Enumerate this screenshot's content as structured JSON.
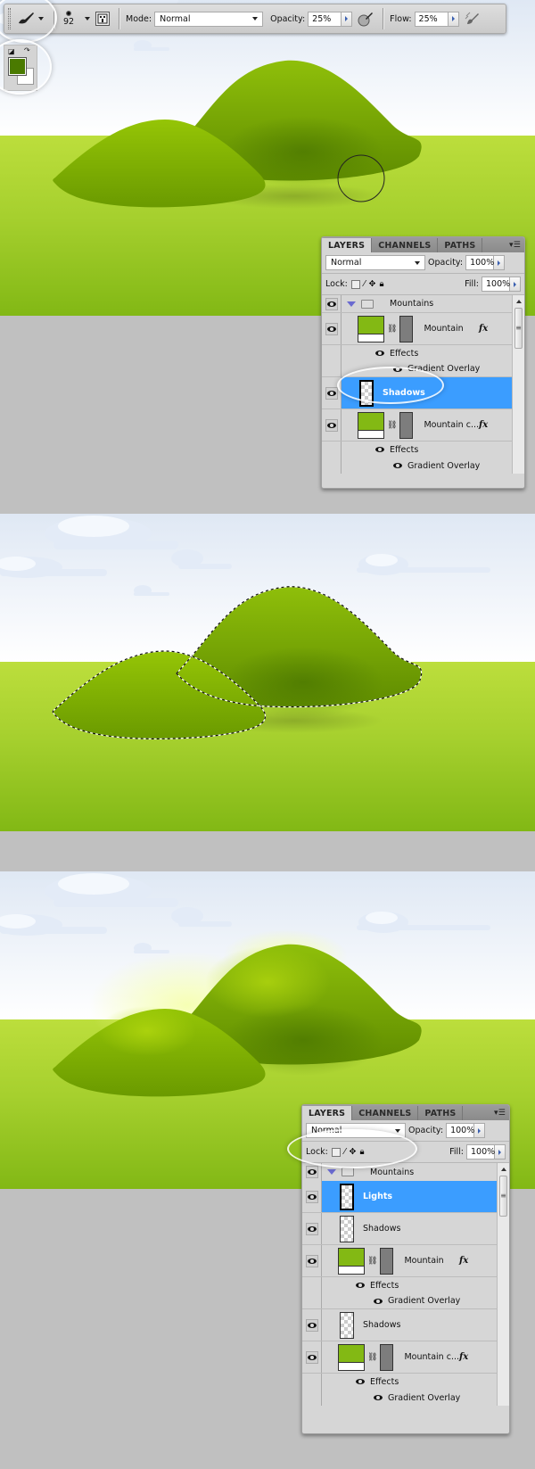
{
  "toolbar": {
    "tool": "brush-icon",
    "brush_size": "92",
    "mode_label": "Mode:",
    "mode_value": "Normal",
    "opacity_label": "Opacity:",
    "opacity_value": "25%",
    "flow_label": "Flow:",
    "flow_value": "25%",
    "airbrush_icons": [
      "tablet-pressure-opacity-icon",
      "airbrush-icon"
    ]
  },
  "colors": {
    "foreground": "#4a7a00",
    "background": "#ffffff",
    "selection": "#3b9dff",
    "canvas_bg": "#c0c0c0"
  },
  "panel1": {
    "tabs": [
      "LAYERS",
      "CHANNELS",
      "PATHS"
    ],
    "blend_mode": "Normal",
    "opacity_label": "Opacity:",
    "opacity_value": "100%",
    "lock_label": "Lock:",
    "fill_label": "Fill:",
    "fill_value": "100%",
    "layers": [
      {
        "name": "Mountains",
        "type": "group"
      },
      {
        "name": "Mountain",
        "type": "shape",
        "fx": "fx"
      },
      {
        "name": "Effects",
        "type": "effects"
      },
      {
        "name": "Gradient Overlay",
        "type": "effect"
      },
      {
        "name": "Shadows",
        "type": "pixel",
        "selected": true
      },
      {
        "name": "Mountain c...",
        "type": "shape",
        "fx": "fx"
      },
      {
        "name": "Effects",
        "type": "effects"
      },
      {
        "name": "Gradient Overlay",
        "type": "effect"
      }
    ]
  },
  "panel2": {
    "tabs": [
      "LAYERS",
      "CHANNELS",
      "PATHS"
    ],
    "blend_mode": "Normal",
    "opacity_label": "Opacity:",
    "opacity_value": "100%",
    "lock_label": "Lock:",
    "fill_label": "Fill:",
    "fill_value": "100%",
    "layers": [
      {
        "name": "Mountains",
        "type": "group"
      },
      {
        "name": "Lights",
        "type": "pixel",
        "selected": true
      },
      {
        "name": "Shadows",
        "type": "pixel"
      },
      {
        "name": "Mountain",
        "type": "shape",
        "fx": "fx"
      },
      {
        "name": "Effects",
        "type": "effects"
      },
      {
        "name": "Gradient Overlay",
        "type": "effect"
      },
      {
        "name": "Shadows",
        "type": "pixel"
      },
      {
        "name": "Mountain c...",
        "type": "shape",
        "fx": "fx"
      },
      {
        "name": "Effects",
        "type": "effects"
      },
      {
        "name": "Gradient Overlay",
        "type": "effect"
      }
    ]
  }
}
